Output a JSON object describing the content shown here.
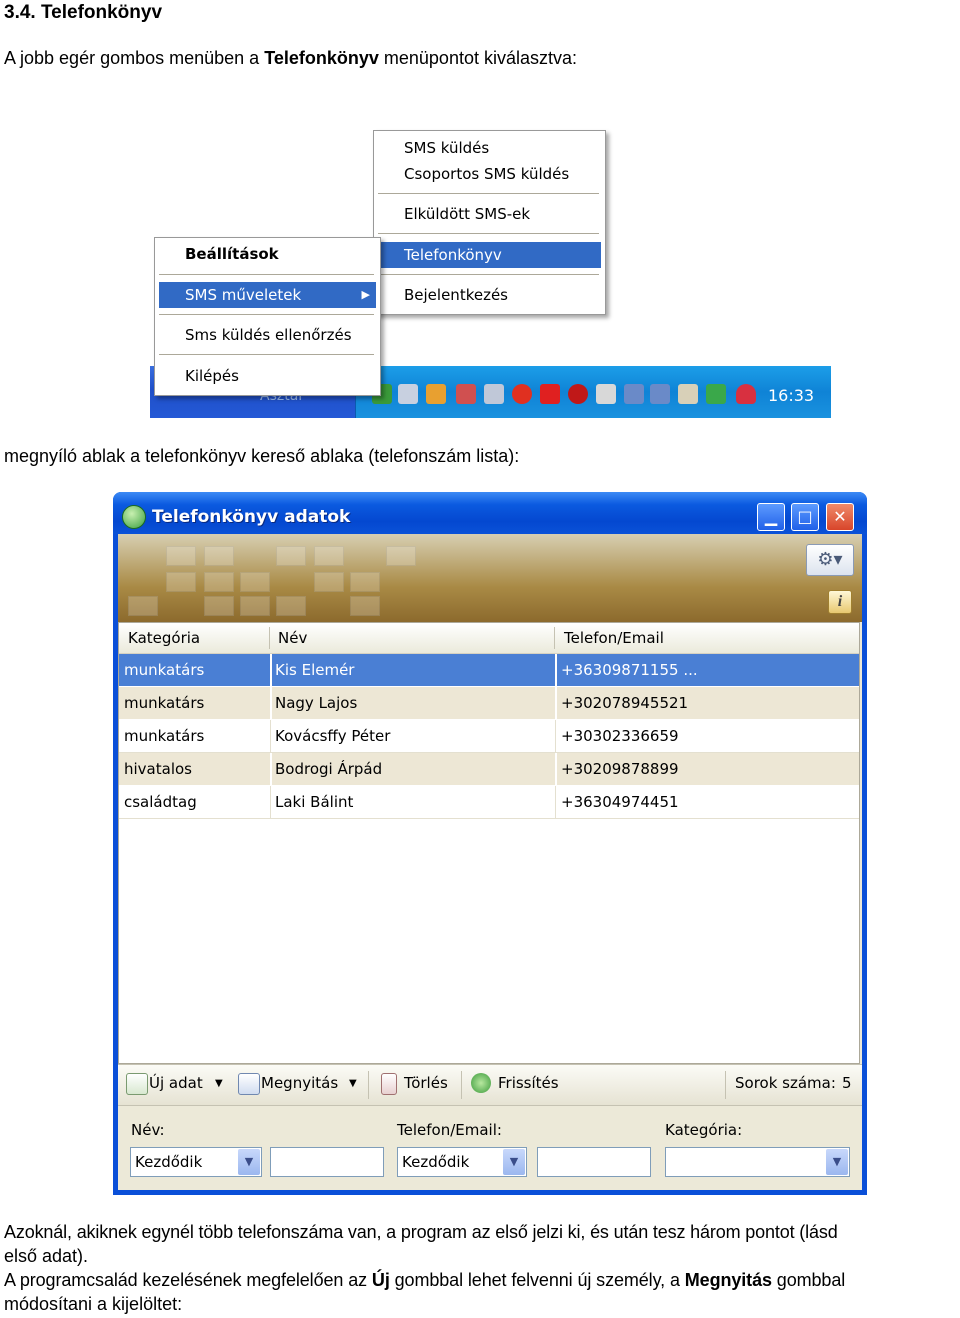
{
  "document": {
    "heading": "3.4. Telefonkönyv",
    "intro": {
      "before": "A jobb egér gombos menüben a ",
      "bold": "Telefonkönyv",
      "after": " menüpontot kiválasztva:"
    },
    "caption2": "megnyíló ablak a telefonkönyv kereső ablaka (telefonszám lista):",
    "p3_line1": "Azoknál, akiknek egynél több telefonszáma van, a program az első jelzi ki, és után tesz három pontot (lásd",
    "p3_line2": "első adat).",
    "p4": {
      "a": "A programcsalád kezelésének megfelelően az ",
      "b": "Új",
      "c": " gombbal lehet felvenni új személy, a ",
      "d": "Megnyitás",
      "e": " gombbal"
    },
    "p4_line2": "módosítani a kijelöltet:"
  },
  "context_menu": {
    "main": {
      "settings": "Beállítások",
      "sms_ops": "SMS műveletek",
      "check": "Sms küldés ellenőrzés",
      "exit": "Kilépés"
    },
    "sub": {
      "send": "SMS küldés",
      "group_send": "Csoportos SMS küldés",
      "sent": "Elküldött SMS-ek",
      "phonebook": "Telefonkönyv",
      "login": "Bejelentkezés"
    },
    "taskbar_label": "Asztal",
    "clock": "16:33"
  },
  "phonebook": {
    "title": "Telefonkönyv adatok",
    "columns": [
      "Kategória",
      "Név",
      "Telefon/Email"
    ],
    "rows": [
      [
        "munkatárs",
        "Kis Elemér",
        "+36309871155 ..."
      ],
      [
        "munkatárs",
        "Nagy Lajos",
        "+302078945521"
      ],
      [
        "munkatárs",
        "Kovácsffy Péter",
        "+30302336659"
      ],
      [
        "hivatalos",
        "Bodrogi Árpád",
        "+30209878899"
      ],
      [
        "családtag",
        "Laki Bálint",
        "+36304974451"
      ]
    ],
    "toolbar": {
      "new": "Új adat",
      "open": "Megnyitás",
      "delete": "Törlés",
      "refresh": "Frissítés",
      "rowcount_label": "Sorok száma:",
      "rowcount": "5"
    },
    "filters": {
      "name_label": "Név:",
      "name_combo": "Kezdődik",
      "phone_label": "Telefon/Email:",
      "phone_combo": "Kezdődik",
      "category_label": "Kategória:"
    }
  },
  "colors": {
    "selection": "#316ac5",
    "title_bar": "#0a52d8",
    "banner": "#a98a45"
  }
}
